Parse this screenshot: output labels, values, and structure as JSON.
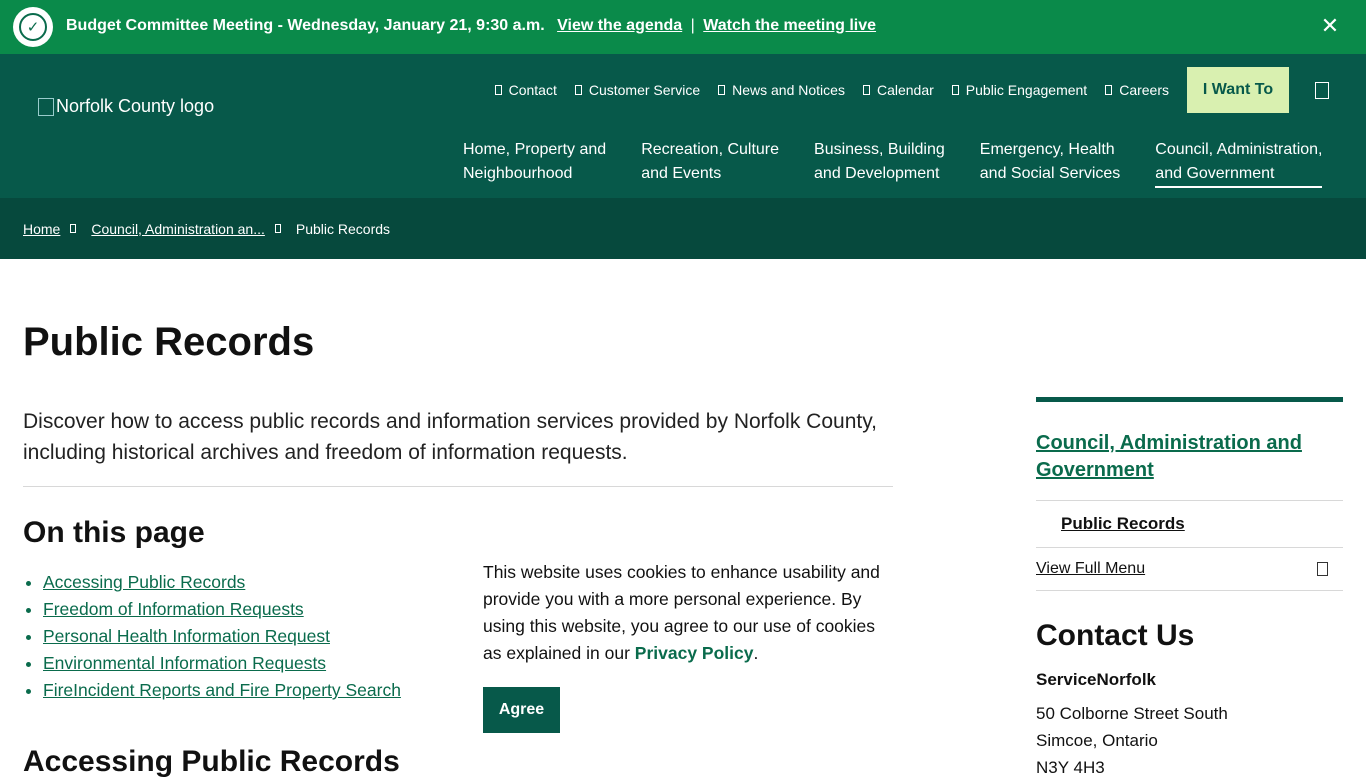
{
  "alert": {
    "icon": "check-circle-icon",
    "text": "Budget Committee Meeting - Wednesday, January 21, 9:30 a.m.",
    "agenda_link": "View the agenda",
    "separator": "|",
    "live_link": "Watch the meeting live",
    "close_icon": "close-icon"
  },
  "header": {
    "logo_alt": "Norfolk County logo",
    "utility": [
      "Contact",
      "Customer Service",
      "News and Notices",
      "Calendar",
      "Public Engagement",
      "Careers"
    ],
    "i_want_to": "I Want To",
    "nav": [
      {
        "line1": "Home, Property and",
        "line2": "Neighbourhood"
      },
      {
        "line1": "Recreation, Culture",
        "line2": "and Events"
      },
      {
        "line1": "Business, Building",
        "line2": "and Development"
      },
      {
        "line1": "Emergency, Health",
        "line2": "and Social Services"
      },
      {
        "line1": "Council, Administration,",
        "line2": "and Government"
      }
    ]
  },
  "breadcrumb": {
    "home": "Home",
    "parent": "Council, Administration an...",
    "current": "Public Records"
  },
  "main": {
    "title": "Public Records",
    "intro": "Discover how to access public records and information services provided by Norfolk County, including historical archives and freedom of information requests.",
    "on_this_page": "On this page",
    "toc": [
      "Accessing Public Records",
      "Freedom of Information Requests",
      "Personal Health Information Request",
      "Environmental Information Requests",
      "FireIncident Reports and Fire Property Search"
    ],
    "section_heading": "Accessing Public Records"
  },
  "cookie": {
    "text": "This website uses cookies to enhance usability and provide you with a more personal experience. By using this website, you agree to our use of cookies as explained in our",
    "link": "Privacy Policy",
    "end": ".",
    "agree": "Agree"
  },
  "sidebar": {
    "heading": "Council, Administration and Government",
    "item": "Public Records",
    "full_menu": "View Full Menu",
    "contact_heading": "Contact Us",
    "contact_name": "ServiceNorfolk",
    "address_line1": "50 Colborne Street South",
    "address_line2": "Simcoe, Ontario",
    "address_line3": "N3Y 4H3"
  }
}
